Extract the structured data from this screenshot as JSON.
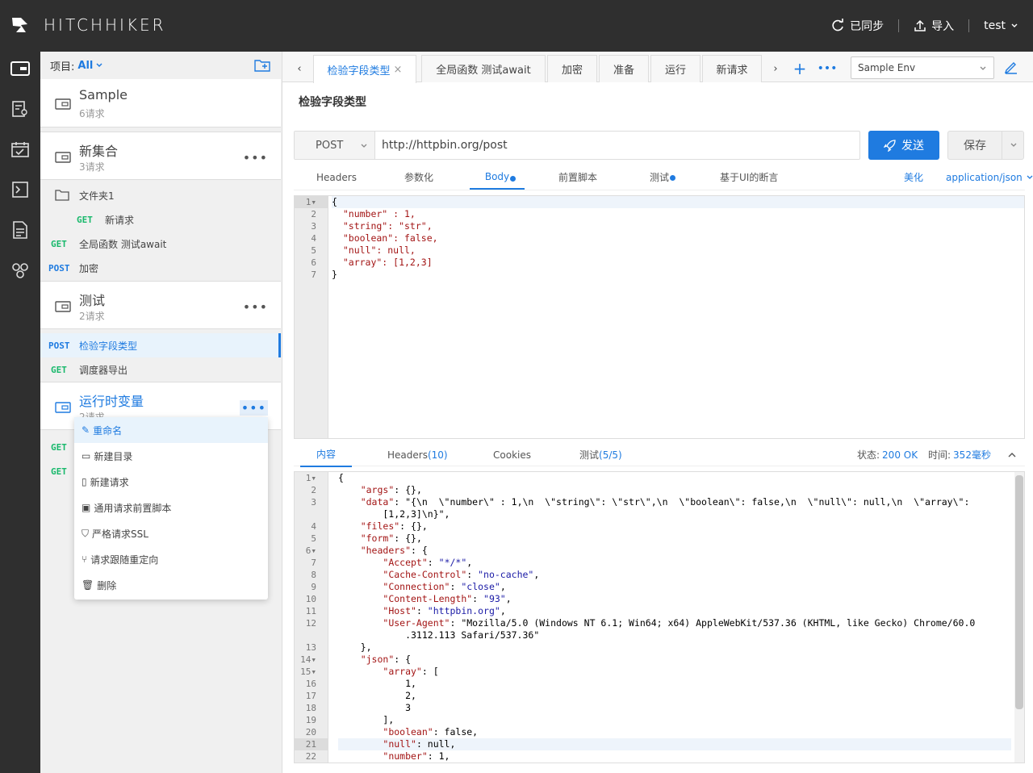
{
  "app": {
    "logo_text": "HITCHHIKER",
    "brand_color": "#1f7be0"
  },
  "topbar": {
    "sync_label": "已同步",
    "import_label": "导入",
    "user": "test"
  },
  "rail": {
    "icons": [
      "wallet-icon",
      "user-doc-icon",
      "calendar-icon",
      "terminal-icon",
      "document-icon",
      "team-icon"
    ]
  },
  "sidebar": {
    "project_label": "项目:",
    "project_value": "All",
    "collections": [
      {
        "name": "Sample",
        "count": "6请求"
      },
      {
        "name": "新集合",
        "count": "3请求"
      },
      {
        "name": "测试",
        "count": "2请求"
      },
      {
        "name": "运行时变量",
        "count": "2请求"
      }
    ],
    "folder": {
      "name": "文件夹1"
    },
    "requests_new_collection": [
      {
        "method": "GET",
        "name": "新请求"
      },
      {
        "method": "GET",
        "name": "全局函数 测试await"
      },
      {
        "method": "POST",
        "name": "加密"
      }
    ],
    "requests_test": [
      {
        "method": "POST",
        "name": "检验字段类型"
      },
      {
        "method": "GET",
        "name": "调度器导出"
      }
    ],
    "requests_runtime": [
      {
        "method": "GET",
        "name": ""
      },
      {
        "method": "GET",
        "name": ""
      }
    ],
    "context_menu": [
      "重命名",
      "新建目录",
      "新建请求",
      "通用请求前置脚本",
      "严格请求SSL",
      "请求跟随重定向",
      "删除"
    ]
  },
  "tabs": [
    "检验字段类型",
    "全局函数 测试await",
    "加密",
    "准备",
    "运行",
    "新请求"
  ],
  "env": "Sample Env",
  "request": {
    "title": "检验字段类型",
    "method": "POST",
    "url": "http://httpbin.org/post",
    "send_label": "发送",
    "save_label": "保存",
    "subtabs": [
      "Headers",
      "参数化",
      "Body",
      "前置脚本",
      "测试",
      "基于UI的断言"
    ],
    "beautify": "美化",
    "content_type": "application/json",
    "body_lines": [
      "{",
      "  \"number\" : 1,",
      "  \"string\": \"str\",",
      "  \"boolean\": false,",
      "  \"null\": null,",
      "  \"array\": [1,2,3]",
      "}"
    ]
  },
  "response": {
    "tabs": {
      "content": "内容",
      "headers": "Headers",
      "headers_count": "(10)",
      "cookies": "Cookies",
      "tests": "测试",
      "tests_count": "(5/5)"
    },
    "status_label": "状态:",
    "status_value": "200 OK",
    "time_label": "时间:",
    "time_value": "352毫秒",
    "line_numbers": [
      "1",
      "2",
      "3",
      "",
      "4",
      "5",
      "6",
      "7",
      "8",
      "9",
      "10",
      "11",
      "12",
      "",
      "13",
      "14",
      "15",
      "16",
      "17",
      "18",
      "19",
      "20",
      "21",
      "22"
    ],
    "lines": [
      "{",
      "    \"args\": {},",
      "    \"data\": \"{\\n  \\\"number\\\" : 1,\\n  \\\"string\\\": \\\"str\\\",\\n  \\\"boolean\\\": false,\\n  \\\"null\\\": null,\\n  \\\"array\\\":",
      "        [1,2,3]\\n}\",",
      "    \"files\": {},",
      "    \"form\": {},",
      "    \"headers\": {",
      "        \"Accept\": \"*/*\",",
      "        \"Cache-Control\": \"no-cache\",",
      "        \"Connection\": \"close\",",
      "        \"Content-Length\": \"93\",",
      "        \"Host\": \"httpbin.org\",",
      "        \"User-Agent\": \"Mozilla/5.0 (Windows NT 6.1; Win64; x64) AppleWebKit/537.36 (KHTML, like Gecko) Chrome/60.0",
      "            .3112.113 Safari/537.36\"",
      "    },",
      "    \"json\": {",
      "        \"array\": [",
      "            1,",
      "            2,",
      "            3",
      "        ],",
      "        \"boolean\": false,",
      "        \"null\": null,",
      "        \"number\": 1,"
    ]
  }
}
